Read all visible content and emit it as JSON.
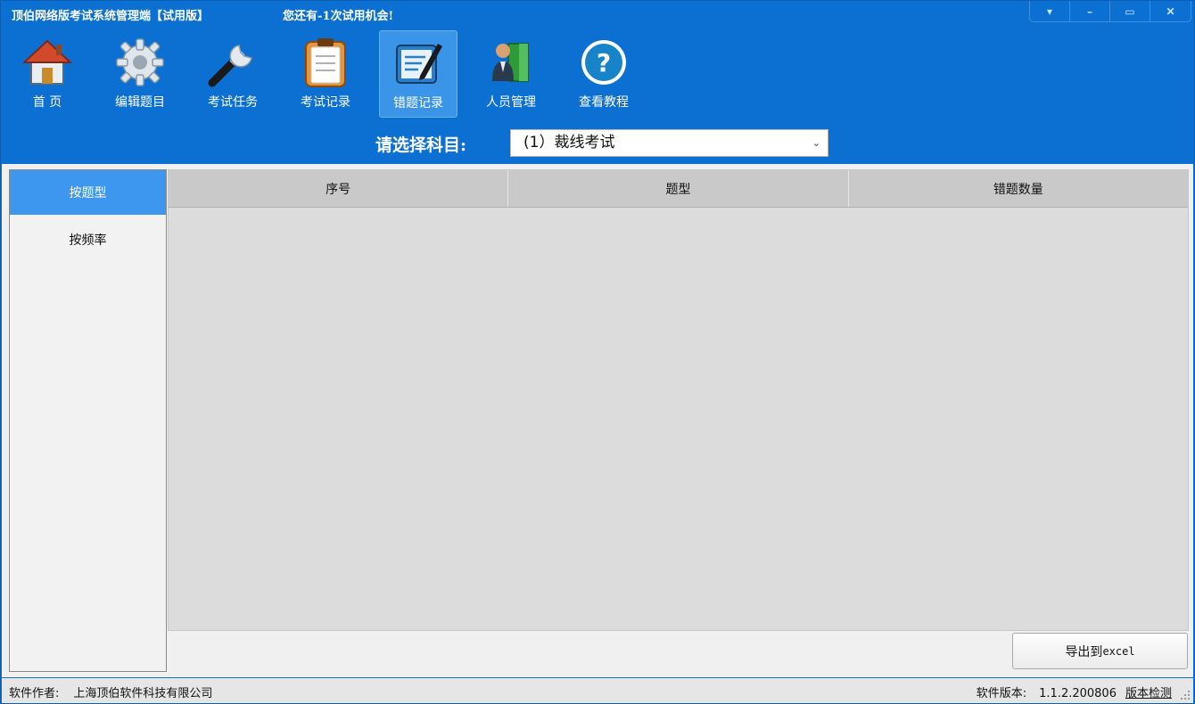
{
  "titlebar": {
    "app_title": "顶伯网络版考试系统管理端【试用版】",
    "trial_msg": "您还有-1次试用机会!",
    "controls": [
      "▾",
      "–",
      "▭",
      "✕"
    ]
  },
  "toolbar": {
    "items": [
      {
        "label": "首  页",
        "icon": "home-icon"
      },
      {
        "label": "编辑题目",
        "icon": "gear-icon"
      },
      {
        "label": "考试任务",
        "icon": "wrench-icon"
      },
      {
        "label": "考试记录",
        "icon": "clipboard-icon"
      },
      {
        "label": "错题记录",
        "icon": "notepad-edit-icon",
        "active": true
      },
      {
        "label": "人员管理",
        "icon": "people-icon"
      },
      {
        "label": "查看教程",
        "icon": "help-icon"
      }
    ]
  },
  "subject": {
    "label": "请选择科目:",
    "selected": "(1）裁线考试"
  },
  "sidebar": {
    "items": [
      {
        "label": "按题型",
        "active": true
      },
      {
        "label": "按频率"
      }
    ]
  },
  "grid": {
    "columns": [
      "序号",
      "题型",
      "错题数量"
    ],
    "rows": []
  },
  "export_button": {
    "label_cn": "导出到",
    "label_en": "excel"
  },
  "statusbar": {
    "author_label": "软件作者:",
    "author": "上海顶伯软件科技有限公司",
    "version_label": "软件版本:",
    "version": "1.1.2.200806",
    "check_label": "版本检测"
  },
  "colors": {
    "chrome_blue": "#0b70d2",
    "active_tab": "#3d97ee",
    "grid_bg": "#dcdcdc"
  }
}
